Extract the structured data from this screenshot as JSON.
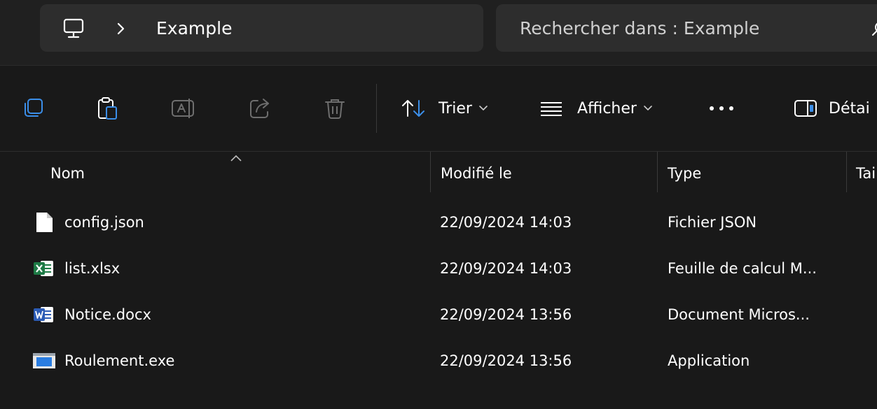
{
  "address": {
    "location_icon": "monitor-icon",
    "separator_icon": "chevron-right-icon",
    "current_folder": "Example"
  },
  "search": {
    "placeholder": "Rechercher dans : Example",
    "icon": "search-icon"
  },
  "toolbar": {
    "copy_icon": "copy-icon",
    "paste_icon": "paste-icon",
    "rename_icon": "rename-icon",
    "share_icon": "share-icon",
    "delete_icon": "trash-icon",
    "sort_label": "Trier",
    "view_label": "Afficher",
    "more_icon": "more-icon",
    "details_label": "Détai"
  },
  "columns": {
    "name": "Nom",
    "modified": "Modifié le",
    "type": "Type",
    "size": "Tai"
  },
  "files": [
    {
      "name": "config.json",
      "modified": "22/09/2024 14:03",
      "type": "Fichier JSON",
      "icon": "generic-file-icon"
    },
    {
      "name": "list.xlsx",
      "modified": "22/09/2024 14:03",
      "type": "Feuille de calcul M...",
      "icon": "excel-file-icon"
    },
    {
      "name": "Notice.docx",
      "modified": "22/09/2024 13:56",
      "type": "Document Micros...",
      "icon": "word-file-icon"
    },
    {
      "name": "Roulement.exe",
      "modified": "22/09/2024 13:56",
      "type": "Application",
      "icon": "application-icon"
    }
  ],
  "colors": {
    "background": "#191919",
    "bar_background": "#202020",
    "field_background": "#2d2d2d",
    "accent_blue": "#3b8ee8",
    "excel_green": "#1d7a45",
    "word_blue": "#2b5bb5",
    "disabled_icon": "#6e6e6e"
  }
}
